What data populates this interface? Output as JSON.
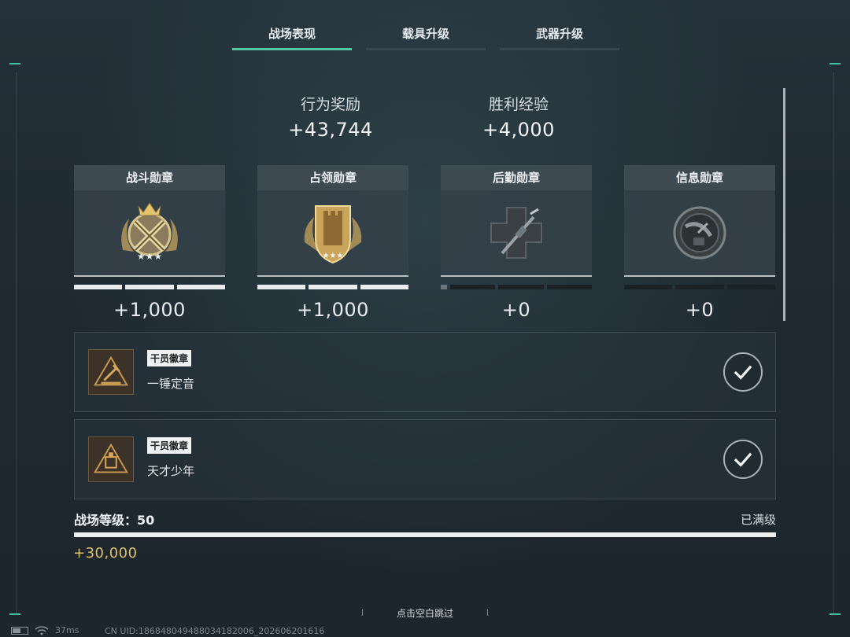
{
  "tabs": [
    {
      "label": "战场表现",
      "active": true
    },
    {
      "label": "载具升级",
      "active": false
    },
    {
      "label": "武器升级",
      "active": false
    }
  ],
  "rewards": {
    "behavior": {
      "label": "行为奖励",
      "value": "+43,744"
    },
    "victory": {
      "label": "胜利经验",
      "value": "+4,000"
    }
  },
  "medals": [
    {
      "name": "战斗勋章",
      "amount": "+1,000",
      "progress_segments_filled": 3,
      "icon": "combat-medal-icon"
    },
    {
      "name": "占领勋章",
      "amount": "+1,000",
      "progress_segments_filled": 3,
      "icon": "capture-medal-icon"
    },
    {
      "name": "后勤勋章",
      "amount": "+0",
      "progress_segments_filled": 0,
      "icon": "logistics-medal-icon"
    },
    {
      "name": "信息勋章",
      "amount": "+0",
      "progress_segments_filled": 0,
      "icon": "intel-medal-icon"
    }
  ],
  "badges": [
    {
      "tag": "干员徽章",
      "name": "一锤定音",
      "icon": "hammer-badge-icon"
    },
    {
      "tag": "干员徽章",
      "name": "天才少年",
      "icon": "genius-badge-icon"
    }
  ],
  "level": {
    "label": "战场等级：50",
    "status": "已满级",
    "gain": "+30,000",
    "fill_fraction": 1.0
  },
  "footer": {
    "skip": "点击空白跳过",
    "ping": "37ms",
    "uid": "CN UID:18684804948803418200​6_202606201616"
  },
  "colors": {
    "accent": "#56c7a6",
    "gold": "#e2c06a",
    "background": "#1e2930"
  }
}
